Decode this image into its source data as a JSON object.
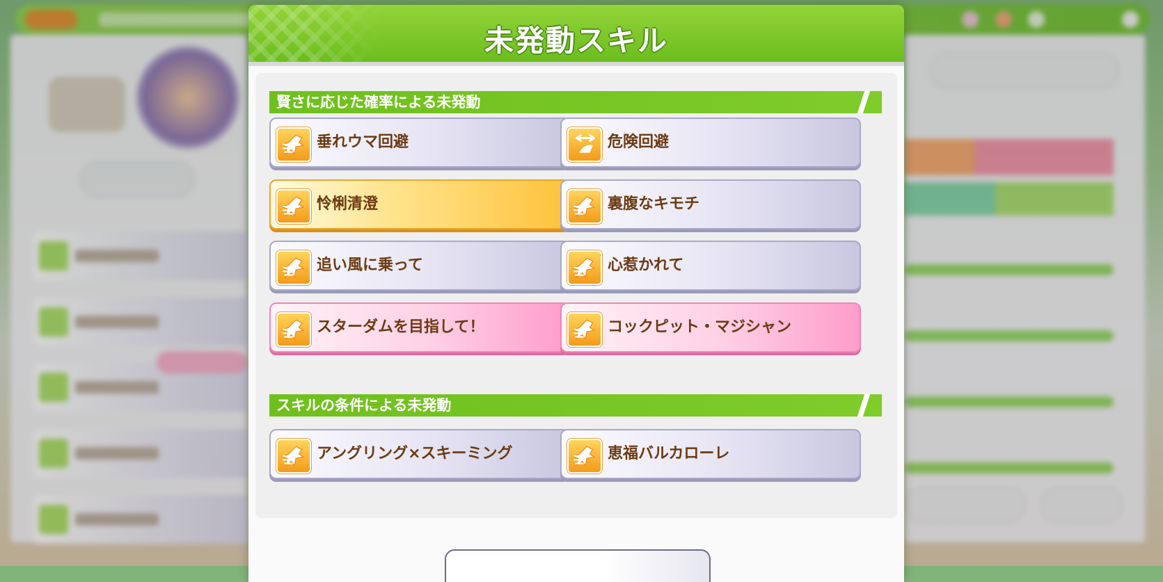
{
  "dialog": {
    "title": "未発動スキル"
  },
  "sections": [
    {
      "heading": "賢さに応じた確率による未発動",
      "skills": [
        {
          "name": "垂れウマ回避",
          "style": "normal",
          "icon": "speed-dash-icon"
        },
        {
          "name": "危険回避",
          "style": "normal",
          "icon": "avoid-arrow-icon"
        },
        {
          "name": "怜悧清澄",
          "style": "gold",
          "icon": "speed-dash-icon"
        },
        {
          "name": "裏腹なキモチ",
          "style": "normal",
          "icon": "speed-dash-icon"
        },
        {
          "name": "追い風に乗って",
          "style": "normal",
          "icon": "speed-dash-icon"
        },
        {
          "name": "心惹かれて",
          "style": "normal",
          "icon": "speed-dash-icon"
        },
        {
          "name": "スターダムを目指して！",
          "style": "pink",
          "icon": "speed-dash-icon"
        },
        {
          "name": "コックピット・マジシャン",
          "style": "pink",
          "icon": "speed-dash-icon"
        }
      ]
    },
    {
      "heading": "スキルの条件による未発動",
      "skills": [
        {
          "name": "アングリング×スキーミング",
          "style": "normal",
          "icon": "speed-dash-icon"
        },
        {
          "name": "恵福バルカローレ",
          "style": "normal",
          "icon": "speed-dash-icon"
        }
      ]
    }
  ],
  "colors": {
    "header_green": "#6cbd1e",
    "skill_text": "#6b3a12",
    "gold_card": "#ffc23c",
    "pink_card": "#ff9ccb"
  }
}
